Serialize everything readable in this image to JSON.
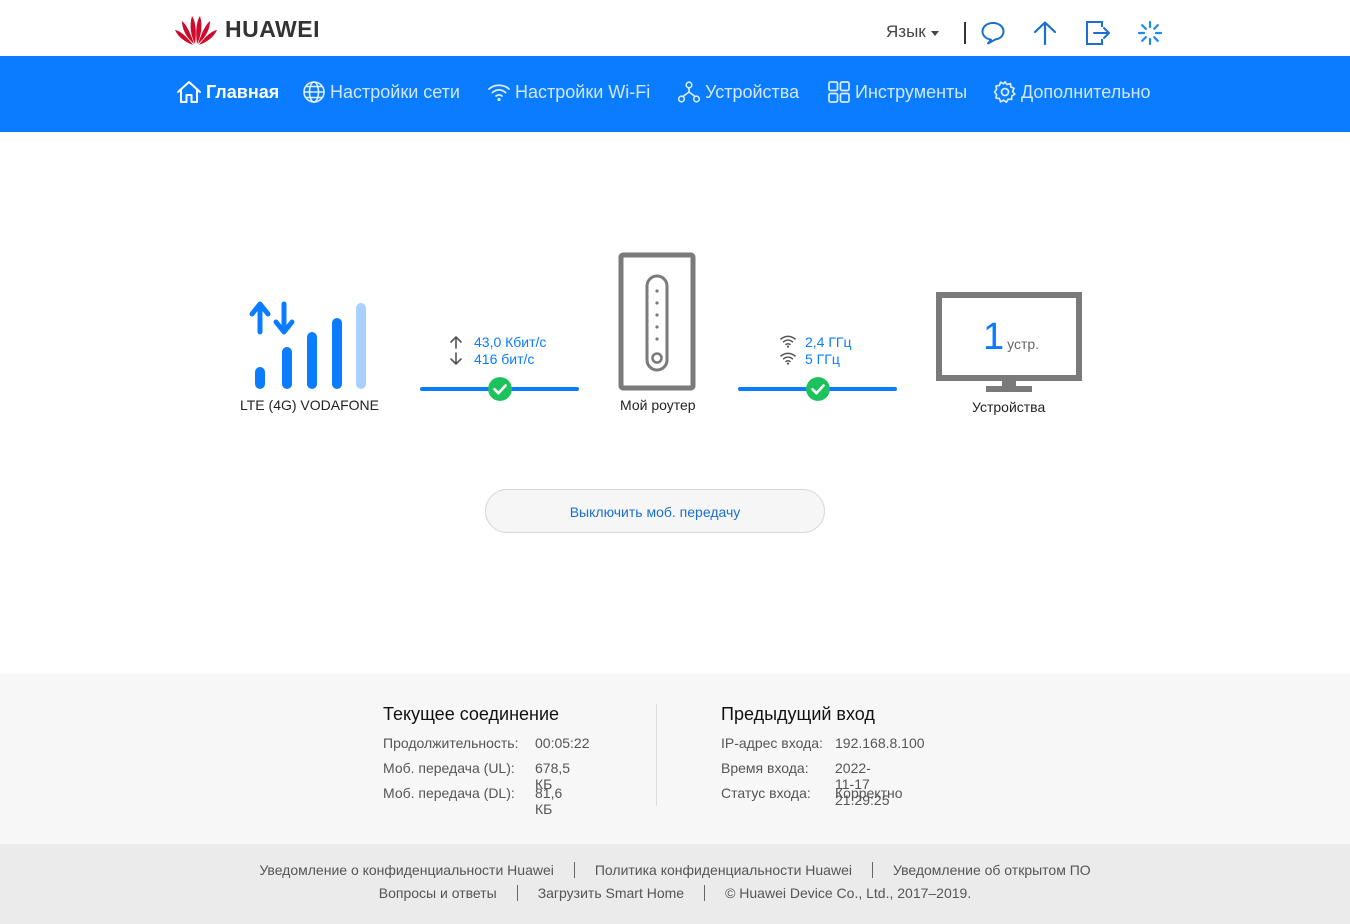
{
  "header": {
    "brand": "HUAWEI",
    "language_label": "Язык",
    "icons": [
      "message-icon",
      "update-icon",
      "logout-icon",
      "loading-icon"
    ]
  },
  "nav": {
    "items": [
      {
        "label": "Главная",
        "icon": "home-icon",
        "active": true
      },
      {
        "label": "Настройки сети",
        "icon": "globe-icon"
      },
      {
        "label": "Настройки Wi-Fi",
        "icon": "wifi-icon"
      },
      {
        "label": "Устройства",
        "icon": "devices-icon"
      },
      {
        "label": "Инструменты",
        "icon": "tools-icon"
      },
      {
        "label": "Дополнительно",
        "icon": "gear-icon"
      }
    ]
  },
  "status": {
    "network_label": "LTE (4G) VODAFONE",
    "upload_rate": "43,0 Кбит/с",
    "download_rate": "416 бит/с",
    "router_label": "Мой роутер",
    "wifi_band_1": "2,4 ГГц",
    "wifi_band_2": "5 ГГц",
    "device_count": "1",
    "device_unit": "устр.",
    "devices_label": "Устройства",
    "signal_bars": 4,
    "signal_bars_max": 5
  },
  "actions": {
    "mobile_data_button": "Выключить моб. передачу"
  },
  "current_connection": {
    "title": "Текущее соединение",
    "rows": [
      {
        "key": "Продолжительность:",
        "value": "00:05:22"
      },
      {
        "key": "Моб. передача (UL):",
        "value": "678,5 КБ"
      },
      {
        "key": "Моб. передача (DL):",
        "value": "81,6 КБ"
      }
    ]
  },
  "previous_login": {
    "title": "Предыдущий вход",
    "rows": [
      {
        "key": "IP-адрес входа:",
        "value": "192.168.8.100"
      },
      {
        "key": "Время входа:",
        "value": "2022-11-17 21:29:25"
      },
      {
        "key": "Статус входа:",
        "value": "Корректно"
      }
    ]
  },
  "footer": {
    "links_row1": [
      "Уведомление о конфиденциальности Huawei",
      "Политика конфиденциальности Huawei",
      "Уведомление об открытом ПО"
    ],
    "links_row2": [
      "Вопросы и ответы",
      "Загрузить Smart Home"
    ],
    "copyright": "© Huawei Device Co., Ltd., 2017–2019."
  },
  "colors": {
    "accent": "#0a7cff",
    "success": "#1ec25c",
    "device_gray": "#7a7a7a",
    "brand_red": "#cf0a2c"
  }
}
